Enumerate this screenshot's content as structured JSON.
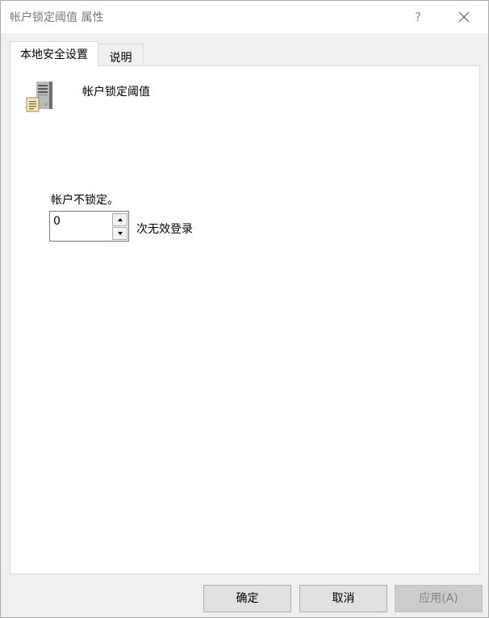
{
  "window": {
    "title": "帐户锁定阈值 属性",
    "help": "?"
  },
  "tabs": [
    {
      "label": "本地安全设置",
      "active": true
    },
    {
      "label": "说明",
      "active": false
    }
  ],
  "policy": {
    "name": "帐户锁定阈值",
    "icon": "server-icon"
  },
  "setting": {
    "status": "帐户不锁定。",
    "value": "0",
    "unit": "次无效登录"
  },
  "buttons": {
    "ok": "确定",
    "cancel": "取消",
    "apply": "应用(A)"
  }
}
